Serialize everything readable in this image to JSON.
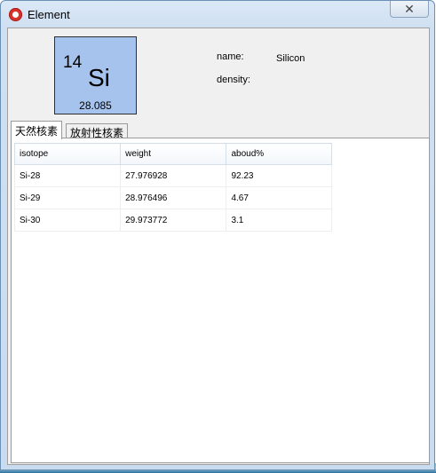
{
  "window": {
    "title": "Element",
    "close_label": "✕"
  },
  "element": {
    "atomic_number": "14",
    "symbol": "Si",
    "atomic_weight": "28.085",
    "card_color": "#a5c3ec"
  },
  "info": {
    "name_label": "name:",
    "name_value": "Silicon",
    "density_label": "density:"
  },
  "tabs": [
    {
      "label": "天然核素",
      "selected": true
    },
    {
      "label": "放射性核素",
      "selected": false
    }
  ],
  "table": {
    "headers": [
      "isotope",
      "weight",
      "aboud%"
    ],
    "rows": [
      [
        "Si-28",
        "27.976928",
        "92.23"
      ],
      [
        "Si-29",
        "28.976496",
        "4.67"
      ],
      [
        "Si-30",
        "29.973772",
        "3.1"
      ]
    ]
  }
}
